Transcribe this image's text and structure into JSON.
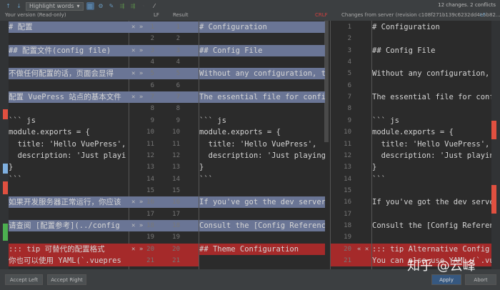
{
  "toolbar": {
    "highlight_mode": "Highlight words",
    "summary": "12 changes. 2 conflicts"
  },
  "headers": {
    "left": "Your version (Read-only)",
    "left_sep": "LF",
    "center": "Result",
    "crlf": "CRLF",
    "right": "Changes from server (revision c108f271b139c6232dd4e5b82...",
    "right_sep": "LF"
  },
  "left_lines": [
    "# 配置",
    "",
    "## 配置文件(config file)",
    "",
    "不做任何配置的话，页面会显得",
    "",
    "配置 VuePress 站点的基本文件",
    "",
    "``` js",
    "module.exports = {",
    "  title: 'Hello VuePress',",
    "  description: 'Just playi",
    "}",
    "```",
    "",
    "如果开发服务器正常运行，你应该",
    "",
    "请查阅 [配置参考](../config",
    "",
    "::: tip 可替代的配置格式",
    "你也可以使用 YAML(`.vuepres"
  ],
  "center_lines": [
    "# Configuration",
    "",
    "## Config File",
    "",
    "Without any configuration, t",
    "",
    "The essential file for confi",
    "",
    "``` js",
    "module.exports = {",
    "  title: 'Hello VuePress',",
    "  description: 'Just playing",
    "}",
    "```",
    "",
    "If you've got the dev server",
    "",
    "Consult the [Config Reference",
    "",
    "## Theme Configuration",
    ""
  ],
  "right_lines": [
    "# Configuration",
    "",
    "## Config File",
    "",
    "Without any configuration, t",
    "",
    "The essential file for confi",
    "",
    "``` js",
    "module.exports = {",
    "  title: 'Hello VuePress',",
    "  description: 'Just playing",
    "}",
    "```",
    "",
    "If you've got the dev serve",
    "",
    "Consult the [Config Referenc",
    "",
    "::: tip Alternative Config F",
    "You can also use YAML (`.vue"
  ],
  "changed_rows": [
    1,
    3,
    5,
    7,
    16,
    18
  ],
  "conflict_rows": [
    20,
    21
  ],
  "markers": {
    "accept_left": "✕ »",
    "accept_right": "« ✕"
  },
  "buttons": {
    "accept_left": "Accept Left",
    "accept_right": "Accept Right",
    "apply": "Apply",
    "abort": "Abort"
  },
  "watermark": "知乎 @云峰",
  "colors": {
    "changed": "#6a7595",
    "conflict": "#a52a2a",
    "apply": "#365880"
  }
}
